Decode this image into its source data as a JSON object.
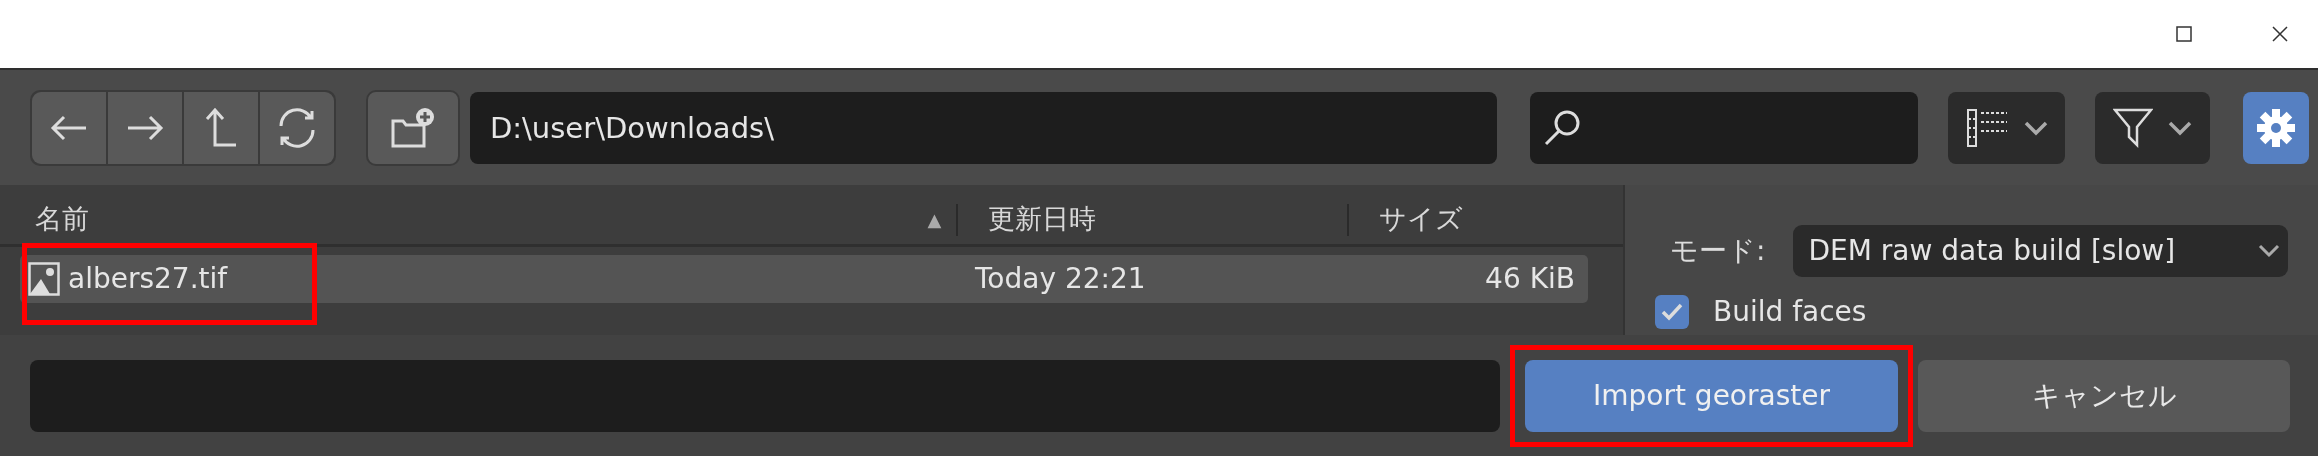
{
  "toolbar": {
    "path": "D:\\user\\Downloads\\"
  },
  "file_list": {
    "columns": [
      {
        "label": "名前",
        "sort_indicator": "▲"
      },
      {
        "label": "更新日時"
      },
      {
        "label": "サイズ"
      }
    ],
    "rows": [
      {
        "name": "albers27.tif",
        "modified": "Today 22:21",
        "size": "46 KiB",
        "selected": true,
        "highlighted": true
      }
    ]
  },
  "options": {
    "mode_label": "モード:",
    "mode_value": "DEM raw data build [slow]",
    "checkboxes": [
      {
        "label": "Build faces",
        "checked": true
      }
    ]
  },
  "bottom": {
    "buttons": [
      {
        "label": "Import georaster",
        "kind": "primary",
        "highlighted": true
      },
      {
        "label": "キャンセル",
        "kind": "secondary",
        "highlighted": false
      }
    ]
  }
}
